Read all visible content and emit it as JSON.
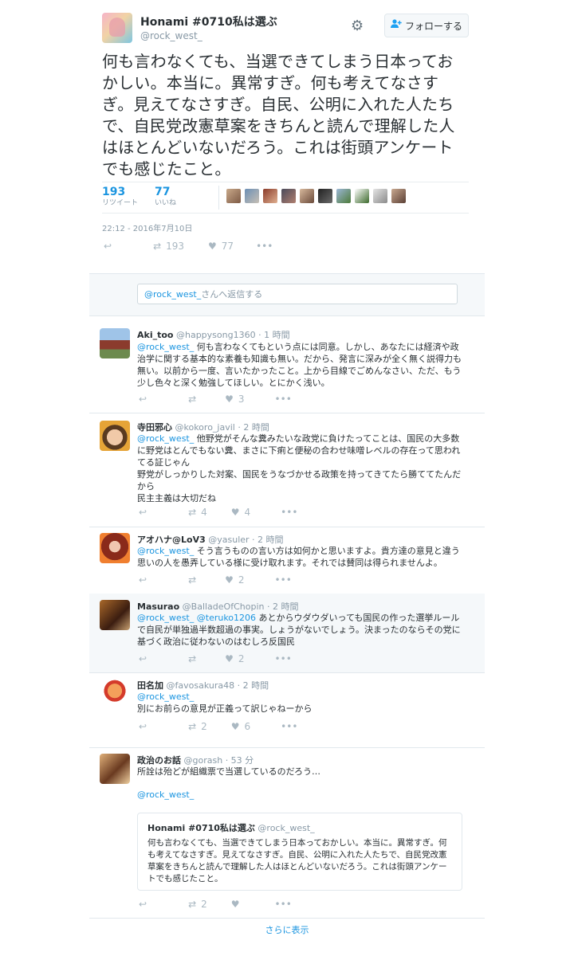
{
  "author": {
    "name": "Honami #0710私は選ぶ",
    "handle": "@rock_west_"
  },
  "follow_label": "フォローする",
  "tweet_text": "何も言わなくても、当選できてしまう日本っておかしい。本当に。異常すぎ。何も考えてなさすぎ。見えてなさすぎ。自民、公明に入れた人たちで、自民党改憲草案をきちんと読んで理解した人はほとんどいないだろう。これは街頭アンケートでも感じたこと。",
  "stats": {
    "retweets": "193",
    "retweets_label": "リツイート",
    "likes": "77",
    "likes_label": "いいね"
  },
  "timestamp": "22:12 - 2016年7月10日",
  "actions": {
    "retweet_count": "193",
    "like_count": "77"
  },
  "reply_box": {
    "mention": "@rock_west_",
    "text": "さんへ返信する"
  },
  "replies": [
    {
      "name": "Aki_too",
      "handle": "@happysong1360",
      "time": "· 1 時間",
      "mention": "@rock_west_",
      "text": "何も言わなくてもという点には同意。しかし、あなたには経済や政治学に関する基本的な素養も知識も無い。だから、発言に深みが全く無く説得力も無い。以前から一度、言いたかったこと。上から目線でごめんなさい、ただ、もう少し色々と深く勉強してほしい。とにかく浅い。",
      "retweets": "",
      "likes": "3"
    },
    {
      "name": "寺田邪心",
      "handle": "@kokoro_javil",
      "time": "· 2 時間",
      "mention": "@rock_west_",
      "text": "他野党がそんな糞みたいな政党に負けたってことは、国民の大多数に野党はとんでもない糞、まさに下痢と便秘の合わせ味噌レベルの存在って思われてる証じゃん",
      "text2": "野党がしっかりした対案、国民をうなづかせる政策を持ってきてたら勝ててたんだから",
      "text3": "民主主義は大切だね",
      "retweets": "4",
      "likes": "4"
    },
    {
      "name": "アオハナ@LoV3",
      "handle": "@yasuler",
      "time": "· 2 時間",
      "mention": "@rock_west_",
      "text": "そう言うものの言い方は如何かと思いますよ。貴方達の意見と違う思いの人を愚弄している様に受け取れます。それでは賛同は得られませんよ。",
      "retweets": "",
      "likes": "2"
    },
    {
      "name": "Masurao",
      "handle": "@BalladeOfChopin",
      "time": "· 2 時間",
      "mention": "@rock_west_",
      "mention2": "@teruko1206",
      "text": "あとからウダウダいっても国民の作った選挙ルールで自民が単独過半数超過の事実。しょうがないでしょう。決まったのならその党に基づく政治に従わないのはむしろ反国民",
      "retweets": "",
      "likes": "2"
    },
    {
      "name": "田名加",
      "handle": "@favosakura48",
      "time": "· 2 時間",
      "mention": "@rock_west_",
      "text": "別にお前らの意見が正義って訳じゃねーから",
      "retweets": "2",
      "likes": "6"
    },
    {
      "name": "政治のお話",
      "handle": "@gorash",
      "time": "· 53 分",
      "text": "所詮は殆どが組織票で当選しているのだろう…",
      "mention": "@rock_west_",
      "retweets": "2",
      "likes": "",
      "quote": {
        "name": "Honami #0710私は選ぶ",
        "handle": "@rock_west_",
        "text": "何も言わなくても、当選できてしまう日本っておかしい。本当に。異常すぎ。何も考えてなさすぎ。見えてなさすぎ。自民、公明に入れた人たちで、自民党改憲草案をきちんと読んで理解した人はほとんどいないだろう。これは街頭アンケートでも感じたこと。"
      }
    }
  ],
  "show_more": "さらに表示"
}
